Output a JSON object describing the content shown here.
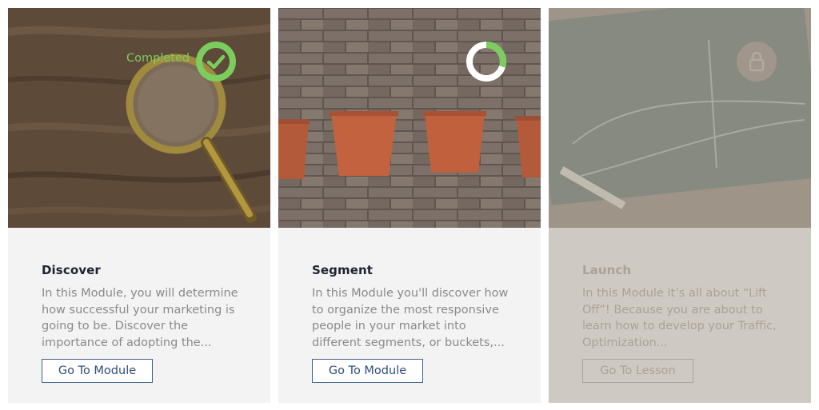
{
  "modules": [
    {
      "title": "Discover",
      "description": "In this Module, you will determine how successful your marketing is going to be. Discover the importance of adopting the...",
      "button_label": "Go To Module",
      "status_label": "Completed",
      "status": "completed",
      "progress": 1.0,
      "locked": false,
      "image_icon": "magnifying-glass-on-wood"
    },
    {
      "title": "Segment",
      "description": "In this Module you'll discover how to organize the most responsive people in your market into different segments, or buckets,...",
      "button_label": "Go To Module",
      "status": "in-progress",
      "progress": 0.3,
      "locked": false,
      "image_icon": "buckets-on-brick-wall"
    },
    {
      "title": "Launch",
      "description": "In this Module it’s all about “Lift Off”! Because you are about to learn how to develop your Traffic, Optimization...",
      "button_label": "Go To Lesson",
      "status": "locked",
      "locked": true,
      "image_icon": "chalkboard-graph"
    }
  ],
  "colors": {
    "completed_green": "#7ccd5d",
    "button_border": "#3d5f8e",
    "card_bg": "#f3f3f3"
  }
}
